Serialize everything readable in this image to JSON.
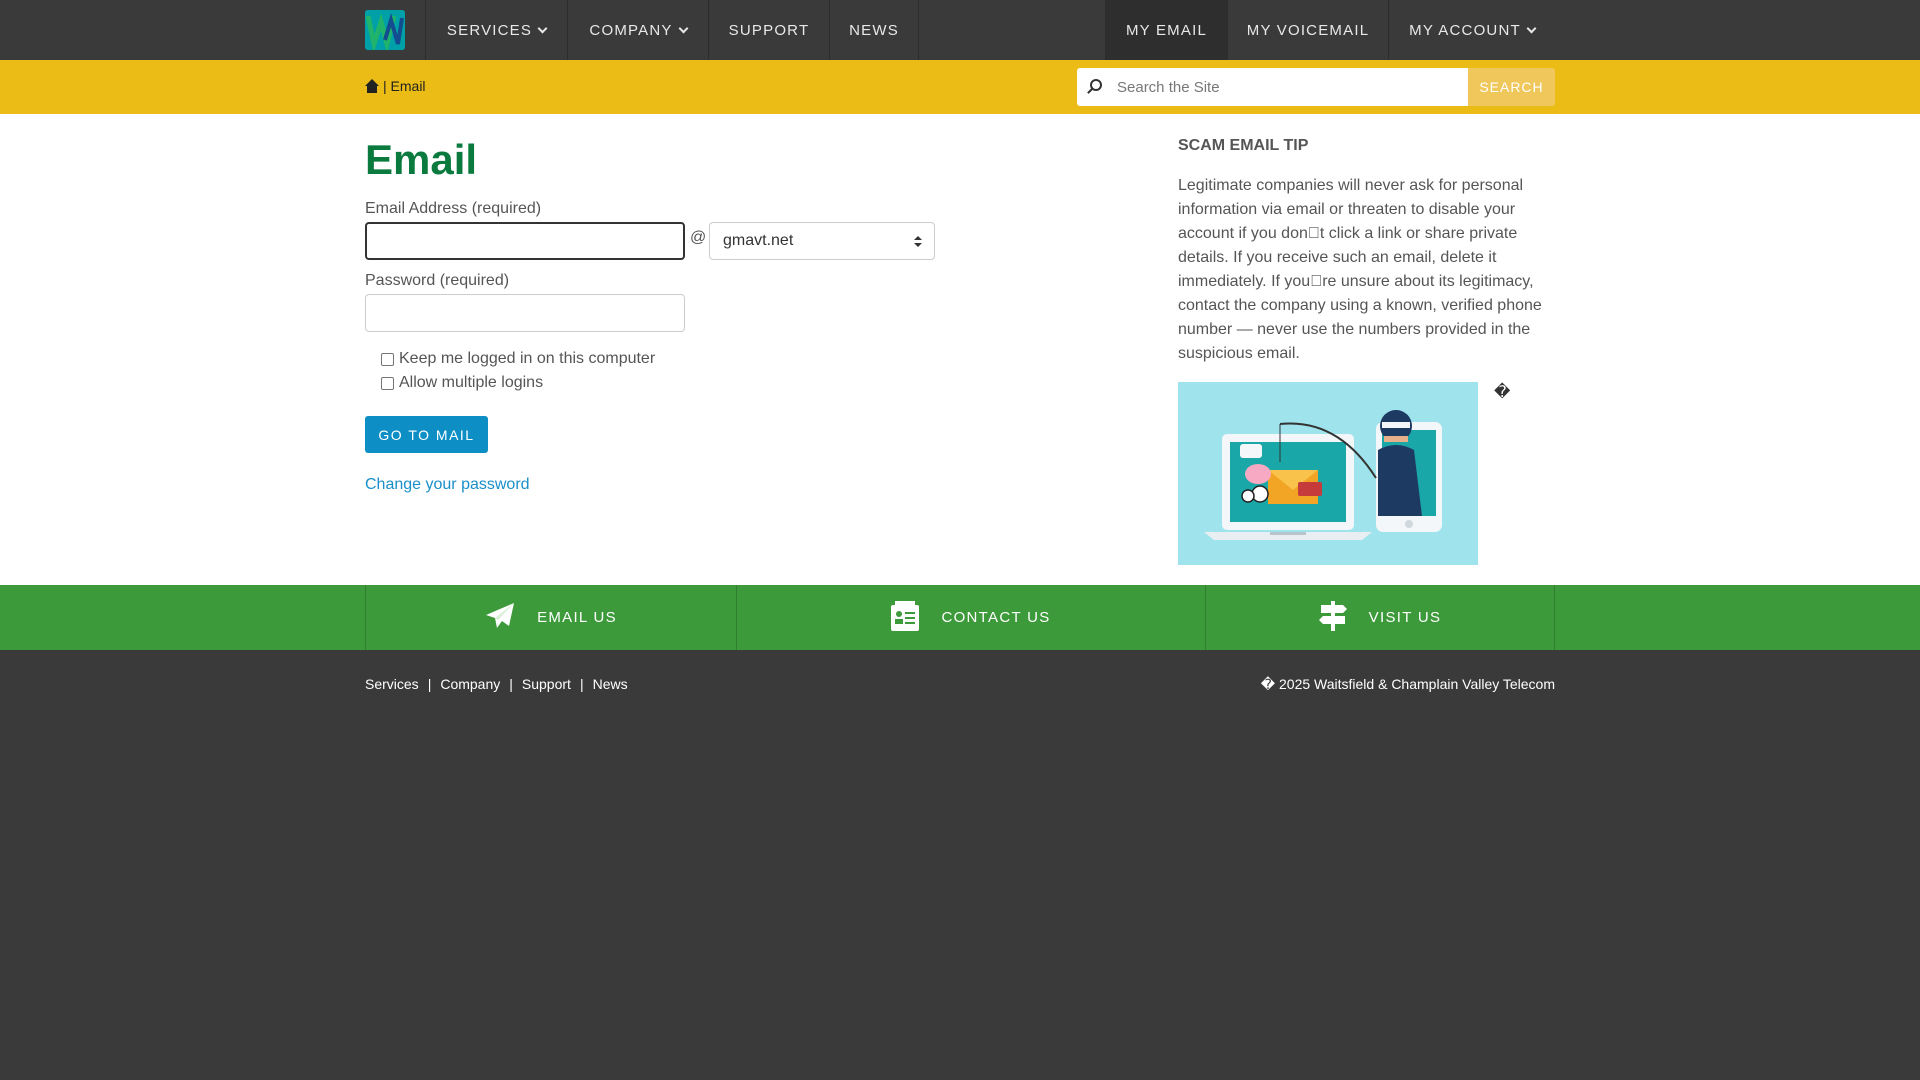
{
  "nav": {
    "left": [
      {
        "label": "SERVICES",
        "has_dropdown": true
      },
      {
        "label": "COMPANY",
        "has_dropdown": true
      },
      {
        "label": "SUPPORT",
        "has_dropdown": false
      },
      {
        "label": "NEWS",
        "has_dropdown": false
      }
    ],
    "right": [
      {
        "label": "MY EMAIL",
        "has_dropdown": false
      },
      {
        "label": "MY VOICEMAIL",
        "has_dropdown": false
      },
      {
        "label": "MY ACCOUNT",
        "has_dropdown": true
      }
    ]
  },
  "breadcrumb": {
    "separator": "|",
    "current": "Email"
  },
  "search": {
    "placeholder": "Search the Site",
    "button_label": "SEARCH"
  },
  "form": {
    "title": "Email",
    "email_label": "Email Address (required)",
    "email_value": "",
    "at_sign": "@",
    "domain_selected": "gmavt.net",
    "password_label": "Password (required)",
    "keep_logged_label": "Keep me logged in on this computer",
    "multi_login_label": "Allow multiple logins",
    "submit_label": "GO TO MAIL",
    "change_password_label": "Change your password"
  },
  "tip": {
    "title": "SCAM EMAIL TIP",
    "text": "Legitimate companies will never ask for personal information via email or threaten to disable your account if you don\u0000t click a link or share private details. If you receive such an email, delete it immediately. If you\u0000re unsure about its legitimacy, contact the company using a known, verified phone number — never use the numbers provided in the suspicious email.",
    "stray_glyph": "�"
  },
  "contact_bar": [
    {
      "label": "EMAIL US",
      "icon": "paper-plane-icon"
    },
    {
      "label": "CONTACT US",
      "icon": "contact-card-icon"
    },
    {
      "label": "VISIT US",
      "icon": "signpost-icon"
    }
  ],
  "footer": {
    "links": [
      "Services",
      "Company",
      "Support",
      "News"
    ],
    "separator": "|",
    "copyright": "� 2025 Waitsfield & Champlain Valley Telecom"
  },
  "colors": {
    "topbar": "#3a3a3a",
    "crumbbar": "#ecbc16",
    "title_green": "#0b7a3e",
    "button_blue": "#0d8fc6",
    "link_blue": "#1a8fc9",
    "contact_green": "#3c9a3a"
  }
}
